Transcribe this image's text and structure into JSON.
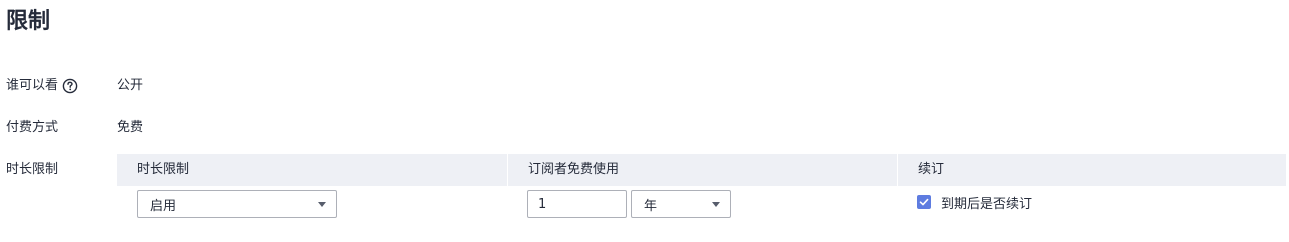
{
  "section": {
    "title": "限制"
  },
  "rows": {
    "visibility": {
      "label": "谁可以看",
      "value": "公开"
    },
    "payment": {
      "label": "付费方式",
      "value": "免费"
    },
    "duration": {
      "label": "时长限制"
    }
  },
  "table": {
    "headers": [
      "时长限制",
      "订阅者免费使用",
      "续订"
    ],
    "status_select": {
      "value": "启用"
    },
    "free_period": {
      "value": "1",
      "unit": "年"
    },
    "renew": {
      "checked": true,
      "label": "到期后是否续订"
    }
  },
  "icons": {
    "help": "help-circle-icon",
    "caret": "caret-down-icon",
    "check": "checkmark-icon"
  },
  "colors": {
    "accent": "#5e7ce0",
    "header_bg": "#eef0f5",
    "text": "#252b3a",
    "border": "#adb0b8"
  }
}
